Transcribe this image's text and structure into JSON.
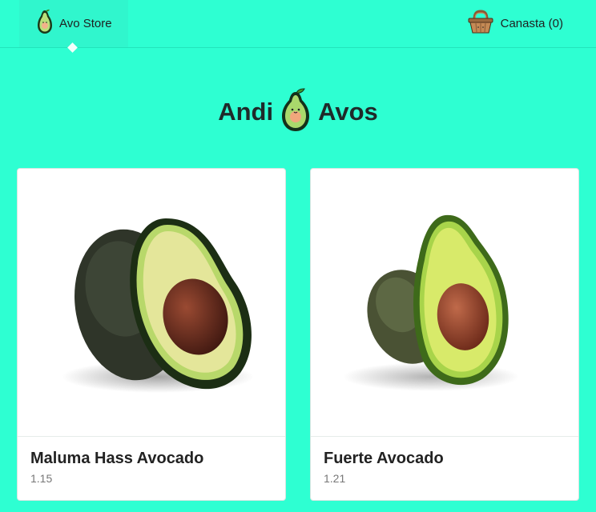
{
  "nav": {
    "brand_label": "Avo Store",
    "brand_icon": "avocado-icon",
    "cart_label": "Canasta (0)",
    "cart_icon": "basket-icon"
  },
  "hero": {
    "left_text": "Andi",
    "right_text": "Avos",
    "logo_icon": "avocado-logo-icon"
  },
  "products": [
    {
      "name": "Maluma Hass Avocado",
      "price": "1.15",
      "image": "hass-avocado-image"
    },
    {
      "name": "Fuerte Avocado",
      "price": "1.21",
      "image": "fuerte-avocado-image"
    }
  ],
  "colors": {
    "background": "#2effd2",
    "nav_active": "#30f6cd",
    "card": "#ffffff"
  }
}
